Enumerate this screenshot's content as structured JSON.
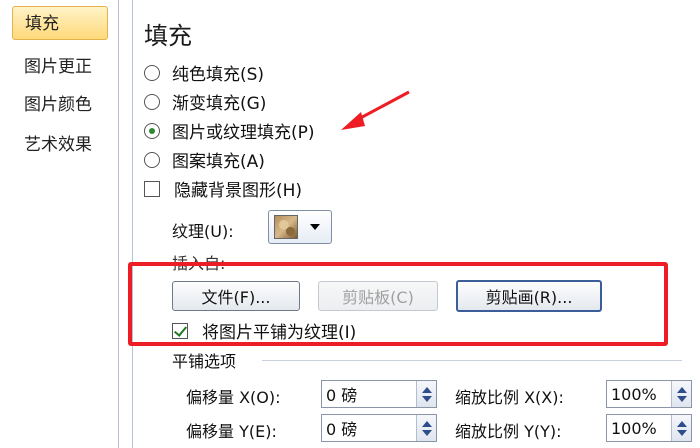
{
  "nav": {
    "items": [
      {
        "label": "填充",
        "selected": true
      },
      {
        "label": "图片更正",
        "selected": false
      },
      {
        "label": "图片颜色",
        "selected": false
      },
      {
        "label": "艺术效果",
        "selected": false
      }
    ]
  },
  "main": {
    "title": "填充",
    "options": {
      "solid": "纯色填充(S)",
      "gradient": "渐变填充(G)",
      "picture": "图片或纹理填充(P)",
      "pattern": "图案填充(A)",
      "hide_bg": "隐藏背景图形(H)"
    },
    "selected_option": "picture",
    "texture_label": "纹理(U):",
    "insert_from_label": "插入自:",
    "buttons": {
      "file": "文件(F)...",
      "clipboard": "剪贴板(C)",
      "clipart": "剪贴画(R)..."
    },
    "tile_checkbox": "将图片平铺为纹理(I)",
    "tile_checked": true,
    "tiling_options_label": "平铺选项",
    "offset_x_label": "偏移量 X(O):",
    "offset_x_value": "0 磅",
    "offset_y_label": "偏移量 Y(E):",
    "offset_y_value": "0 磅",
    "scale_x_label": "缩放比例 X(X):",
    "scale_x_value": "100%",
    "scale_y_label": "缩放比例 Y(Y):",
    "scale_y_value": "100%"
  },
  "colors": {
    "highlight": "#ee1d25",
    "nav_selected": "#ffd97a",
    "radio_selected": "#2f8a2f"
  }
}
